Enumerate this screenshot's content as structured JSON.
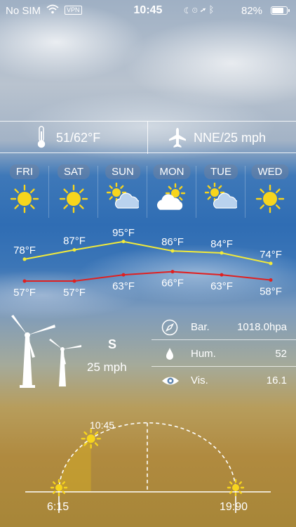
{
  "status_bar": {
    "carrier": "No SIM",
    "vpn": "VPN",
    "time": "10:45",
    "battery_percent": "82%",
    "battery_level": 0.82
  },
  "summary": {
    "temp_range": "51/62°F",
    "wind": "NNE/25 mph"
  },
  "forecast": [
    {
      "day": "FRI",
      "icon": "sun-icon"
    },
    {
      "day": "SAT",
      "icon": "sun-icon"
    },
    {
      "day": "SUN",
      "icon": "partly-cloudy-icon"
    },
    {
      "day": "MON",
      "icon": "cloud-sun-icon"
    },
    {
      "day": "TUE",
      "icon": "partly-cloudy-icon"
    },
    {
      "day": "WED",
      "icon": "sun-icon"
    }
  ],
  "chart_data": {
    "type": "line",
    "categories": [
      "FRI",
      "SAT",
      "SUN",
      "MON",
      "TUE",
      "WED"
    ],
    "series": [
      {
        "color": "#f2ea3a",
        "values": [
          78,
          87,
          95,
          86,
          84,
          74
        ],
        "labels": [
          "78°F",
          "87°F",
          "95°F",
          "86°F",
          "84°F",
          "74°F"
        ]
      },
      {
        "color": "#e02020",
        "values": [
          57,
          57,
          63,
          66,
          63,
          58
        ],
        "labels": [
          "57°F",
          "57°F",
          "63°F",
          "66°F",
          "63°F",
          "58°F"
        ]
      }
    ]
  },
  "wind": {
    "direction": "S",
    "speed": "25 mph"
  },
  "details": [
    {
      "icon": "compass-icon",
      "label": "Bar.",
      "value": "1018.0hpa"
    },
    {
      "icon": "droplet-icon",
      "label": "Hum.",
      "value": "52"
    },
    {
      "icon": "eye-icon",
      "label": "Vis.",
      "value": "16.1"
    }
  ],
  "sun": {
    "sunrise": "6:15",
    "sunset": "19:90",
    "current_time": "10:45",
    "day_progress": 0.28
  }
}
